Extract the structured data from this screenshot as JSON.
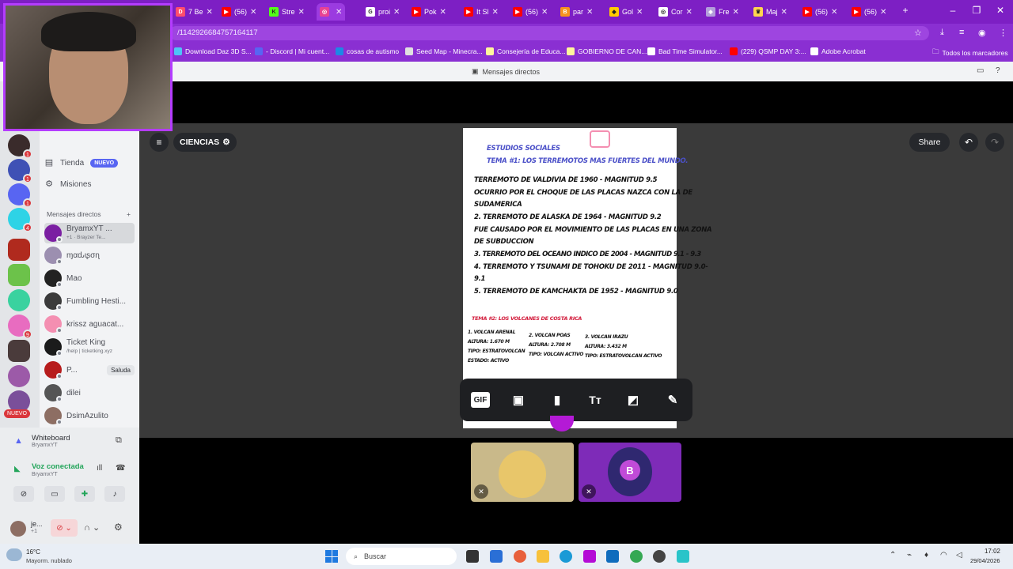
{
  "browser": {
    "tabs": [
      {
        "label": "7 Be",
        "color": "#ff4d6d",
        "glyph": "D"
      },
      {
        "label": "(56)",
        "color": "#ff0000",
        "glyph": "▶"
      },
      {
        "label": "Stre",
        "color": "#53fc18",
        "glyph": "K"
      },
      {
        "label": "",
        "color": "#e84393",
        "glyph": "◎"
      },
      {
        "label": "proi",
        "color": "#ffffff",
        "glyph": "G"
      },
      {
        "label": "Pok",
        "color": "#ff0000",
        "glyph": "▶"
      },
      {
        "label": "It Sl",
        "color": "#ff0000",
        "glyph": "▶"
      },
      {
        "label": "(56)",
        "color": "#ff0000",
        "glyph": "▶"
      },
      {
        "label": "par",
        "color": "#f7931e",
        "glyph": "B"
      },
      {
        "label": "Gol",
        "color": "#ffcc00",
        "glyph": "◆"
      },
      {
        "label": "Cor",
        "color": "#ffffff",
        "glyph": "◎"
      },
      {
        "label": "Fre",
        "color": "#b39ddb",
        "glyph": "◈"
      },
      {
        "label": "Maj",
        "color": "#ffd54f",
        "glyph": "♛"
      },
      {
        "label": "(56)",
        "color": "#ff0000",
        "glyph": "▶"
      },
      {
        "label": "(56)",
        "color": "#ff0000",
        "glyph": "▶"
      }
    ],
    "url": "/1142926684757164117",
    "bookmarks": [
      {
        "label": "Download Daz 3D S...",
        "color": "#4fc3f7"
      },
      {
        "label": "- Discord | Mi cuent...",
        "color": "#5865f2"
      },
      {
        "label": "cosas de autismo",
        "color": "#1e88e5"
      },
      {
        "label": "Seed Map - Minecra...",
        "color": "#e0e0e0"
      },
      {
        "label": "Consejería de Educa...",
        "color": "#fff59d"
      },
      {
        "label": "GOBIERNO DE CAN...",
        "color": "#fff59d"
      },
      {
        "label": "Bad Time Simulator...",
        "color": "#ffffff"
      },
      {
        "label": "(229) QSMP DAY 3:...",
        "color": "#ff0000"
      },
      {
        "label": "Adobe Acrobat",
        "color": "#ffffff"
      }
    ],
    "all_bookmarks": "Todos los marcadores"
  },
  "discord": {
    "title": "Mensajes directos",
    "nav": [
      {
        "label": "Tienda",
        "badge": "NUEVO",
        "icon": "shop-icon"
      },
      {
        "label": "Misiones",
        "icon": "quest-icon"
      }
    ],
    "dm_header": "Mensajes directos",
    "dms": [
      {
        "name": "BryamxYT ...",
        "sub": "+1 · Brayzer Te...",
        "color": "#7b1fa2"
      },
      {
        "name": "ɱαԃιʂσɳ",
        "sub": "",
        "color": "#9c8fb0"
      },
      {
        "name": "Mao",
        "sub": "",
        "color": "#222222"
      },
      {
        "name": "Fumbling Hesti...",
        "sub": "",
        "color": "#3b3b3b"
      },
      {
        "name": "krissz aguacat...",
        "sub": "",
        "color": "#f48fb1"
      },
      {
        "name": "Ticket King",
        "sub": "/help | ticketking.xyz",
        "color": "#1b1b1b"
      },
      {
        "name": "P...",
        "sub": "",
        "color": "#b71c1c",
        "action": "Saluda"
      },
      {
        "name": "dilei",
        "sub": "",
        "color": "#555555"
      },
      {
        "name": "DsimAzulito",
        "sub": "",
        "color": "#8d6e63"
      }
    ],
    "activity": {
      "title": "Whiteboard",
      "sub": "BryamxYT"
    },
    "voice": {
      "title": "Voz conectada",
      "sub": "BryamxYT"
    },
    "user": {
      "name": "je...",
      "sub": "+1"
    },
    "server_badges": [
      "1",
      "1",
      "1",
      "4",
      "9"
    ],
    "nuevo_badge": "NUEVO"
  },
  "call": {
    "channel": "CIENCIAS",
    "share": "Share"
  },
  "whiteboard": {
    "lines": [
      {
        "text": "ESTUDIOS SOCIALES",
        "style": "blue"
      },
      {
        "text": "TEMA #1: LOS TERREMOTOS MAS FUERTES DEL MUNDO.",
        "style": "blue"
      },
      {
        "text": "TERREMOTO DE VALDIVIA DE 1960 - MAGNITUD 9.5",
        "style": "black"
      },
      {
        "text": "OCURRIO POR EL CHOQUE DE LAS PLACAS NAZCA CON LA DE",
        "style": "black"
      },
      {
        "text": "SUDAMERICA",
        "style": "black"
      },
      {
        "text": "2. TERREMOTO DE ALASKA DE 1964 - MAGNITUD 9.2",
        "style": "black"
      },
      {
        "text": "FUE CAUSADO POR EL MOVIMIENTO DE LAS PLACAS EN UNA ZONA",
        "style": "black"
      },
      {
        "text": "DE SUBDUCCION",
        "style": "black"
      },
      {
        "text": "3. TERREMOTO DEL OCEANO INDICO DE 2004 - MAGNITUD 9.1 - 9.3",
        "style": "black"
      },
      {
        "text": "4. TERREMOTO Y TSUNAMI DE TOHOKU DE 2011 - MAGNITUD 9.0-",
        "style": "black"
      },
      {
        "text": "9.1",
        "style": "black"
      },
      {
        "text": "5. TERREMOTO DE KAMCHAKTA DE 1952 - MAGNITUD 9.0",
        "style": "black"
      }
    ],
    "tema2": "TEMA #2: LOS VOLCANES DE COSTA RICA",
    "volcanes": [
      {
        "lines": [
          "1. VOLCAN ARENAL",
          "ALTURA: 1.670 M",
          "TIPO: ESTRATOVOLCAN",
          "ESTADO: ACTIVO"
        ]
      },
      {
        "lines": [
          "2. VOLCAN POAS",
          "ALTURA: 2.708 M",
          "TIPO: VOLCAN ACTIVO"
        ]
      },
      {
        "lines": [
          "3. VOLCAN IRAZU",
          "ALTURA: 3.432 M",
          "TIPO: ESTRATOVOLCAN ACTIVO"
        ]
      }
    ]
  },
  "toolbar": {
    "gif": "GIF",
    "text_tool": "Tт"
  },
  "taskbar": {
    "weather_temp": "16°C",
    "weather_desc": "Mayorm. nublado",
    "search": "Buscar",
    "time": "17:02",
    "date": "29/04/2026"
  }
}
